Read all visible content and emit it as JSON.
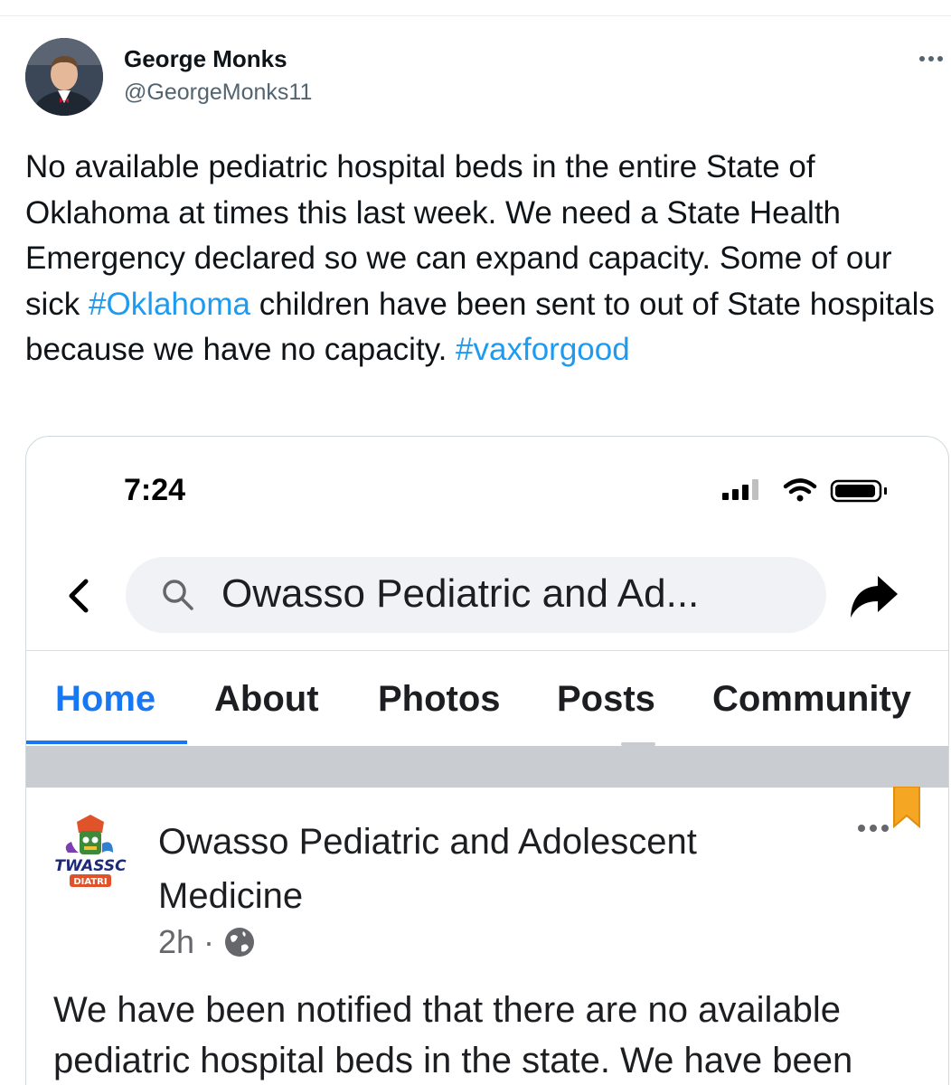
{
  "tweet": {
    "author_name": "George Monks",
    "author_handle": "@GeorgeMonks11",
    "more_label": "•••",
    "text_parts": {
      "p1": "No available pediatric hospital beds in the entire State of Oklahoma at times this last week. We need a State Health Emergency declared so we can expand capacity. Some of our sick ",
      "hashtag1": "#Oklahoma",
      "p2": " children have been sent to out of State hospitals because we have no capacity. ",
      "hashtag2": "#vaxforgood"
    }
  },
  "phone_screenshot": {
    "status_time": "7:24",
    "search_text": "Owasso Pediatric and Ad...",
    "tabs": [
      {
        "label": "Home",
        "active": true
      },
      {
        "label": "About"
      },
      {
        "label": "Photos"
      },
      {
        "label": "Posts"
      },
      {
        "label": "Community"
      }
    ],
    "post": {
      "page_name": "Owasso Pediatric and Adolescent Medicine",
      "logo_text": "TWASSC",
      "logo_subtext": "DIATRI",
      "time_ago": "2h",
      "separator": "·",
      "more_label": "•••",
      "text": "We have been notified that there are no available pediatric hospital beds in the state. We have been"
    }
  },
  "colors": {
    "link": "#1d9bf0",
    "facebook_blue": "#1877f2",
    "bookmark": "#f5a623"
  },
  "icons": [
    "more-icon",
    "back-chevron-icon",
    "search-icon",
    "share-icon",
    "globe-icon",
    "signal-icon",
    "wifi-icon",
    "battery-icon",
    "bookmark-icon"
  ]
}
